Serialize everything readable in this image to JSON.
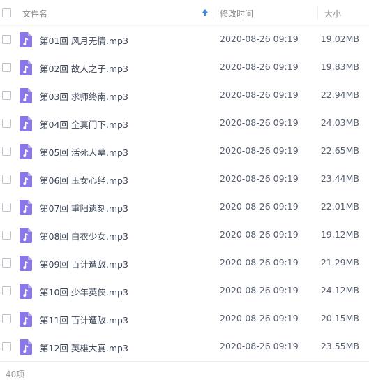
{
  "header": {
    "name_label": "文件名",
    "time_label": "修改时间",
    "size_label": "大小",
    "sort_icon": "arrow-up-icon",
    "accent_color": "#3a8ee6"
  },
  "files": [
    {
      "name": "第01回 风月无情.mp3",
      "time": "2020-08-26 09:19",
      "size": "19.02MB"
    },
    {
      "name": "第02回 故人之子.mp3",
      "time": "2020-08-26 09:19",
      "size": "19.83MB"
    },
    {
      "name": "第03回 求师终南.mp3",
      "time": "2020-08-26 09:19",
      "size": "22.94MB"
    },
    {
      "name": "第04回 全真门下.mp3",
      "time": "2020-08-26 09:19",
      "size": "24.03MB"
    },
    {
      "name": "第05回 活死人墓.mp3",
      "time": "2020-08-26 09:19",
      "size": "22.65MB"
    },
    {
      "name": "第06回 玉女心经.mp3",
      "time": "2020-08-26 09:19",
      "size": "23.44MB"
    },
    {
      "name": "第07回 重阳遗刻.mp3",
      "time": "2020-08-26 09:19",
      "size": "22.01MB"
    },
    {
      "name": "第08回 白衣少女.mp3",
      "time": "2020-08-26 09:19",
      "size": "19.12MB"
    },
    {
      "name": "第09回 百计遭敌.mp3",
      "time": "2020-08-26 09:19",
      "size": "21.29MB"
    },
    {
      "name": "第10回 少年英侠.mp3",
      "time": "2020-08-26 09:19",
      "size": "24.12MB"
    },
    {
      "name": "第11回 百计遭敌.mp3",
      "time": "2020-08-26 09:19",
      "size": "20.15MB"
    },
    {
      "name": "第12回 英雄大宴.mp3",
      "time": "2020-08-26 09:19",
      "size": "23.55MB"
    }
  ],
  "file_icon": "music-file-icon",
  "file_icon_color": "#8b78e6",
  "footer": {
    "count": "40项"
  }
}
